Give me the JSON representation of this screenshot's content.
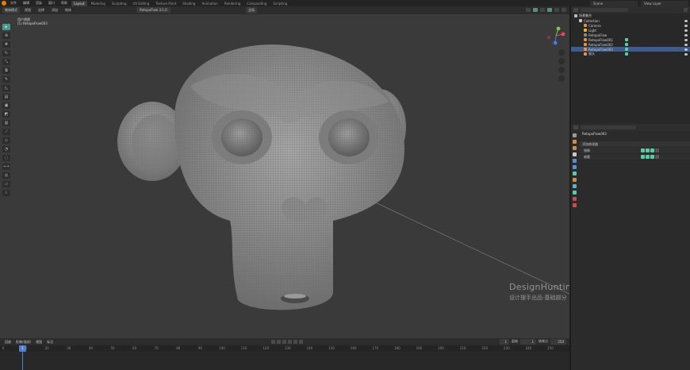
{
  "topbar": {
    "menus": [
      "文件",
      "编辑",
      "渲染",
      "窗口",
      "帮助"
    ],
    "workspaces": [
      "Layout",
      "Modeling",
      "Sculpting",
      "UV Editing",
      "Texture Paint",
      "Shading",
      "Animation",
      "Rendering",
      "Compositing",
      "Scripting"
    ],
    "active_workspace": "Layout",
    "scene": "Scene",
    "view_layer": "View Layer"
  },
  "header": {
    "mode": "物体模式",
    "view_menus": [
      "视图",
      "选择",
      "添加",
      "物体"
    ],
    "transform": "全局",
    "retopo_tab": "RetopoFlow 3.1.0"
  },
  "viewport": {
    "info_line1": "用户透视",
    "info_line2": "(1) RetopoFlow003",
    "watermark_title": "DesignHunting",
    "watermark_sub": "设计搜手出品-基础部分"
  },
  "timeline": {
    "menus": [
      "回放",
      "抠像(插帧)",
      "视图",
      "标记"
    ],
    "current_frame": "1",
    "start_label": "起始",
    "start": "1",
    "end_label": "结束点",
    "end": "250",
    "ruler": [
      "0",
      "10",
      "20",
      "30",
      "40",
      "50",
      "60",
      "70",
      "80",
      "90",
      "100",
      "110",
      "120",
      "130",
      "140",
      "150",
      "160",
      "170",
      "180",
      "190",
      "200",
      "210",
      "220",
      "230",
      "240",
      "250"
    ]
  },
  "outliner": {
    "title": "场景集合",
    "rows": [
      {
        "label": "Collection",
        "indent": 1,
        "color": "#c8c8c8",
        "selected": false,
        "mod": false
      },
      {
        "label": "Camera",
        "indent": 2,
        "color": "#e0904a",
        "selected": false,
        "mod": false
      },
      {
        "label": "Light",
        "indent": 2,
        "color": "#e0b84a",
        "selected": false,
        "mod": false
      },
      {
        "label": "RetopoFlow",
        "indent": 2,
        "color": "#888888",
        "selected": false,
        "mod": false
      },
      {
        "label": "RetopoFlow001",
        "indent": 2,
        "color": "#e0904a",
        "selected": false,
        "mod": true
      },
      {
        "label": "RetopoFlow002",
        "indent": 2,
        "color": "#e0904a",
        "selected": false,
        "mod": true
      },
      {
        "label": "RetopoFlow003",
        "indent": 2,
        "color": "#e0904a",
        "selected": true,
        "mod": true
      },
      {
        "label": "猴头",
        "indent": 2,
        "color": "#e0904a",
        "selected": false,
        "mod": true
      }
    ]
  },
  "properties": {
    "object_name": "RetopoFlow003",
    "panel_title": "添加修改器",
    "modifiers": [
      "镜像",
      "缩裹"
    ],
    "tab_colors": [
      "#9a9a9a",
      "#d08a4a",
      "#d08a4a",
      "#c8c8c8",
      "#5a8fd0",
      "#5a8fd0",
      "#5cc9a7",
      "#d08a4a",
      "#5ab0d0",
      "#5cc9a7",
      "#c84a4a",
      "#d04a4a"
    ]
  },
  "gizmo": {
    "x_color": "#e04a5a",
    "y_color": "#7cc44a",
    "z_color": "#4a80e0"
  }
}
